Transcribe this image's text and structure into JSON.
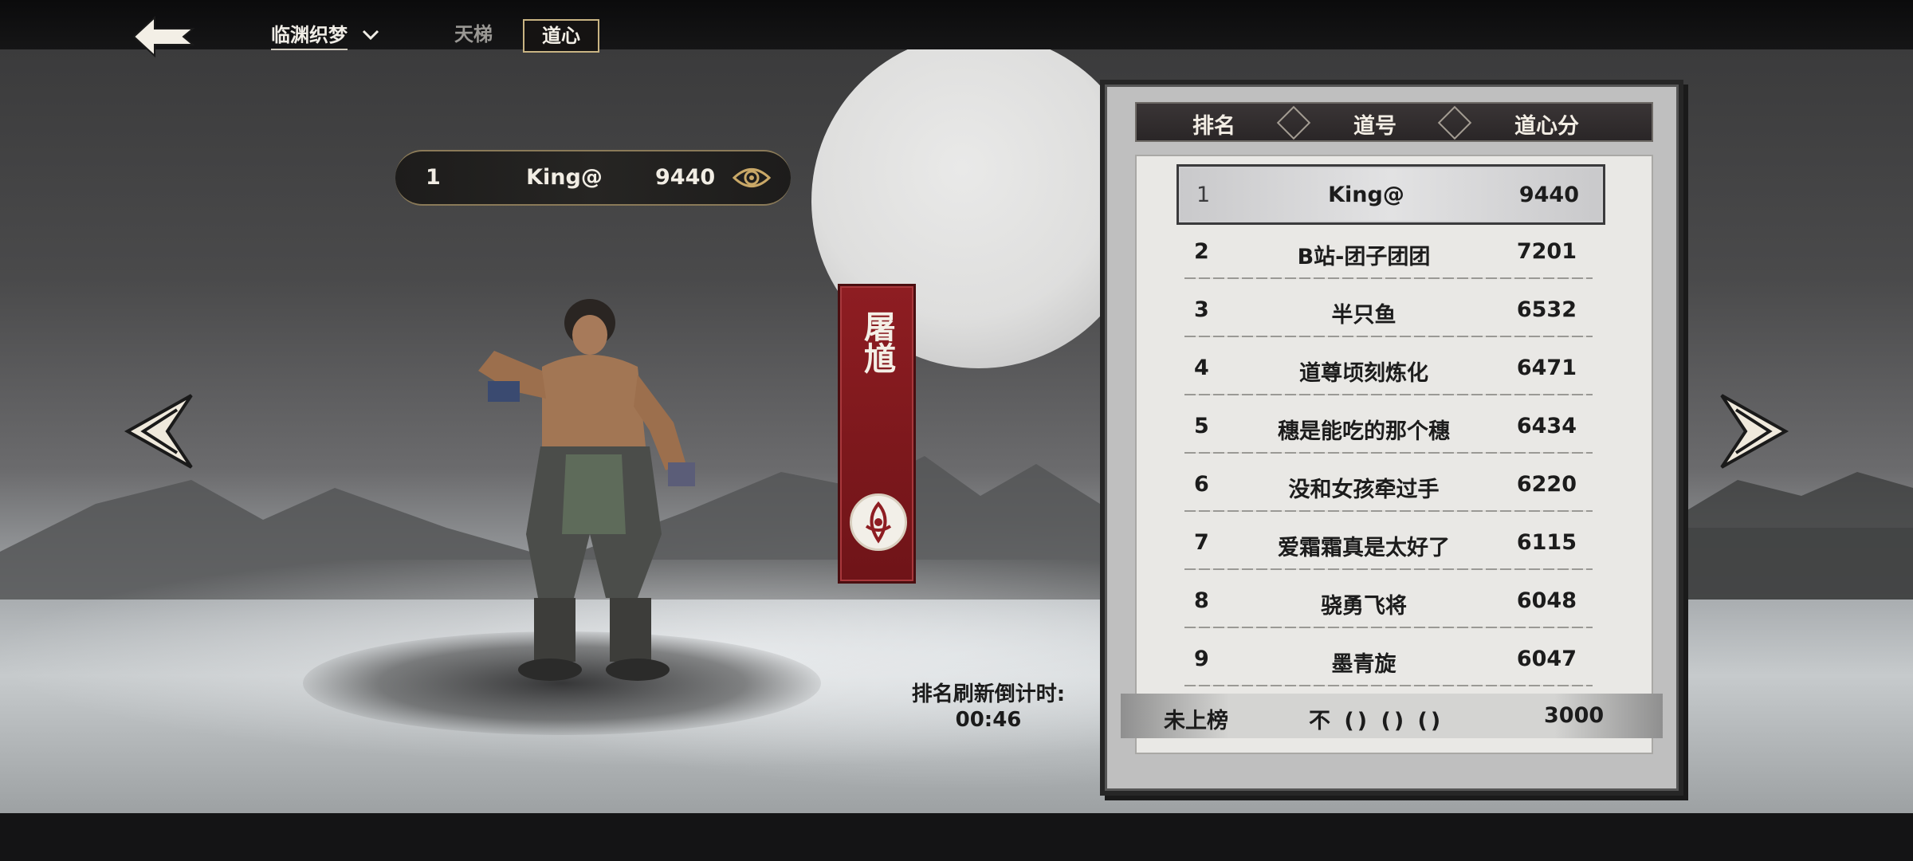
{
  "header": {
    "server_name": "临渊织梦",
    "tabs": [
      {
        "label": "天梯",
        "active": false
      },
      {
        "label": "道心",
        "active": true
      }
    ]
  },
  "player_badge": {
    "rank": "1",
    "name": "King@",
    "score": "9440",
    "icon": "eye-icon"
  },
  "character": {
    "name_banner": "屠馗",
    "emblem_icon": "sect-emblem-icon"
  },
  "refresh": {
    "label": "排名刷新倒计时:",
    "countdown": "00:46"
  },
  "leaderboard": {
    "headers": {
      "rank": "排名",
      "name": "道号",
      "score": "道心分"
    },
    "rows": [
      {
        "rank": "1",
        "name": "King@",
        "score": "9440"
      },
      {
        "rank": "2",
        "name": "B站-团子团团",
        "score": "7201"
      },
      {
        "rank": "3",
        "name": "半只鱼",
        "score": "6532"
      },
      {
        "rank": "4",
        "name": "道尊顷刻炼化",
        "score": "6471"
      },
      {
        "rank": "5",
        "name": "穗是能吃的那个穗",
        "score": "6434"
      },
      {
        "rank": "6",
        "name": "没和女孩牵过手",
        "score": "6220"
      },
      {
        "rank": "7",
        "name": "爱霜霜真是太好了",
        "score": "6115"
      },
      {
        "rank": "8",
        "name": "骁勇飞将",
        "score": "6048"
      },
      {
        "rank": "9",
        "name": "墨青旋",
        "score": "6047"
      }
    ],
    "my_entry": {
      "label": "未上榜",
      "name": "不 () () ()",
      "score": "3000"
    }
  },
  "colors": {
    "banner_red": "#8e1d22",
    "tab_border_gold": "#c9b483",
    "board_panel": "#e9e8e5"
  },
  "icons": [
    "back-arrow-icon",
    "chevron-down-icon",
    "eye-icon",
    "left-arrow-icon",
    "right-arrow-icon",
    "sect-emblem-icon"
  ]
}
